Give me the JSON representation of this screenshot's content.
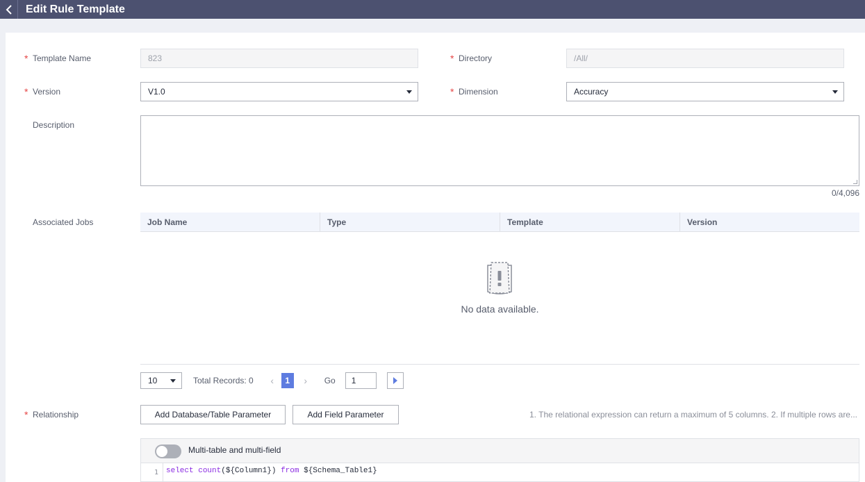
{
  "header": {
    "title": "Edit Rule Template"
  },
  "form": {
    "template_name": {
      "label": "Template Name",
      "value": "823"
    },
    "directory": {
      "label": "Directory",
      "value": "/All/"
    },
    "version": {
      "label": "Version",
      "value": "V1.0"
    },
    "dimension": {
      "label": "Dimension",
      "value": "Accuracy"
    },
    "description": {
      "label": "Description",
      "counter": "0/4,096"
    },
    "associated_jobs": {
      "label": "Associated Jobs",
      "columns": [
        "Job Name",
        "Type",
        "Template",
        "Version"
      ],
      "empty_text": "No data available."
    },
    "pagination": {
      "page_size": "10",
      "total": "Total Records: 0",
      "current_page": "1",
      "go_label": "Go",
      "go_value": "1"
    },
    "relationship": {
      "label": "Relationship",
      "add_db_table_label": "Add Database/Table Parameter",
      "add_field_label": "Add Field Parameter",
      "hint": "1. The relational expression can return a maximum of 5 columns. 2. If multiple rows are..."
    },
    "editor": {
      "toggle_label": "Multi-table and multi-field",
      "toggle_on": false,
      "line_number": "1",
      "code": {
        "kw1": "select",
        "kw2": "count",
        "p1": "${Column1})",
        "kw3": "from",
        "p2": "${Schema_Table1}"
      }
    }
  },
  "colors": {
    "header_bg": "#4c5170",
    "primary": "#5e7ce0",
    "required": "#e54545"
  }
}
